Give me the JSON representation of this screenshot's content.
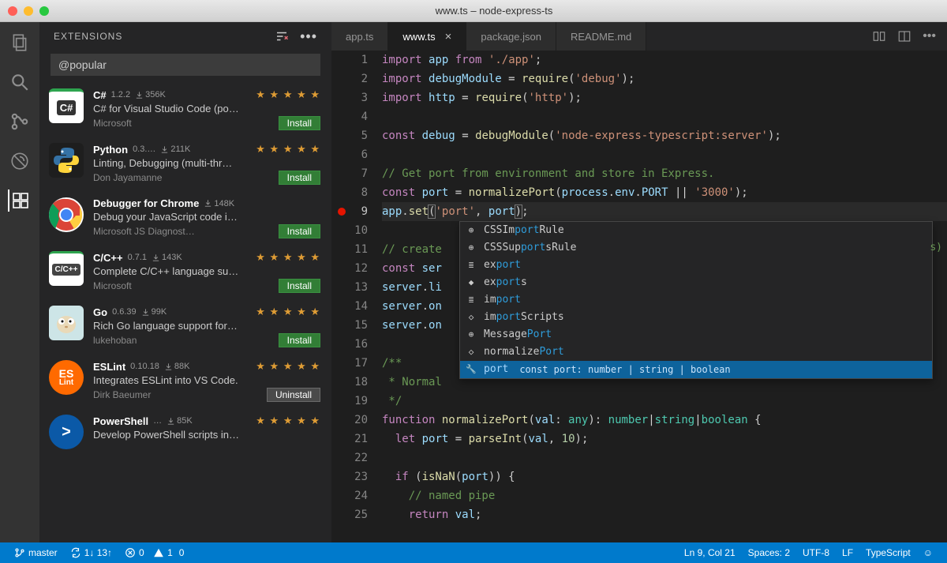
{
  "window": {
    "title": "www.ts – node-express-ts"
  },
  "sidebar": {
    "heading": "EXTENSIONS",
    "search_value": "@popular"
  },
  "extensions": [
    {
      "name": "C#",
      "ver": "1.2.2",
      "downloads": "356K",
      "stars": "★ ★ ★ ★ ★",
      "desc": "C# for Visual Studio Code (po…",
      "publisher": "Microsoft",
      "button": "Install",
      "icon_bg": "#fff",
      "icon_label": "C#",
      "icon_color": "#333",
      "icon_style": "csharp"
    },
    {
      "name": "Python",
      "ver": "0.3.…",
      "downloads": "211K",
      "stars": "★ ★ ★ ★ ★",
      "desc": "Linting, Debugging (multi-thr…",
      "publisher": "Don Jayamanne",
      "button": "Install",
      "icon_bg": "#1e1e1e",
      "icon_label": "Py",
      "icon_color": "#ffd43b",
      "icon_style": "python"
    },
    {
      "name": "Debugger for Chrome",
      "ver": "",
      "downloads": "148K",
      "stars": "",
      "desc": "Debug your JavaScript code i…",
      "publisher": "Microsoft JS Diagnost…",
      "button": "Install",
      "icon_bg": "#fff",
      "icon_label": "",
      "icon_color": "",
      "icon_style": "chrome"
    },
    {
      "name": "C/C++",
      "ver": "0.7.1",
      "downloads": "143K",
      "stars": "★ ★ ★ ★ ★",
      "desc": "Complete C/C++ language su…",
      "publisher": "Microsoft",
      "button": "Install",
      "icon_bg": "#fff",
      "icon_label": "C/C++",
      "icon_color": "#333",
      "icon_style": "cpp"
    },
    {
      "name": "Go",
      "ver": "0.6.39",
      "downloads": "99K",
      "stars": "★ ★ ★ ★ ★",
      "desc": "Rich Go language support for…",
      "publisher": "lukehoban",
      "button": "Install",
      "icon_bg": "#d9e9ea",
      "icon_label": "Go",
      "icon_color": "#333",
      "icon_style": "go"
    },
    {
      "name": "ESLint",
      "ver": "0.10.18",
      "downloads": "88K",
      "stars": "★ ★ ★ ★ ★",
      "desc": "Integrates ESLint into VS Code.",
      "publisher": "Dirk Baeumer",
      "button": "Uninstall",
      "icon_bg": "#ff6a00",
      "icon_label": "ES Lint",
      "icon_color": "#fff",
      "icon_style": "eslint"
    },
    {
      "name": "PowerShell",
      "ver": "…",
      "downloads": "85K",
      "stars": "★ ★ ★ ★ ★",
      "desc": "Develop PowerShell scripts in…",
      "publisher": "",
      "button": "",
      "icon_bg": "#0b59a7",
      "icon_label": ">",
      "icon_color": "#fff",
      "icon_style": "ps"
    }
  ],
  "tabs": [
    {
      "label": "app.ts",
      "active": false
    },
    {
      "label": "www.ts",
      "active": true
    },
    {
      "label": "package.json",
      "active": false
    },
    {
      "label": "README.md",
      "active": false
    }
  ],
  "code_lines": [
    {
      "n": 1,
      "html": "<span class='kw'>import</span> <span class='var'>app</span> <span class='kw'>from</span> <span class='str'>'./app'</span>;"
    },
    {
      "n": 2,
      "html": "<span class='kw'>import</span> <span class='var'>debugModule</span> <span class='op'>=</span> <span class='fn'>require</span>(<span class='str'>'debug'</span>);"
    },
    {
      "n": 3,
      "html": "<span class='kw'>import</span> <span class='var'>http</span> <span class='op'>=</span> <span class='fn'>require</span>(<span class='str'>'http'</span>);"
    },
    {
      "n": 4,
      "html": ""
    },
    {
      "n": 5,
      "html": "<span class='kw'>const</span> <span class='var'>debug</span> <span class='op'>=</span> <span class='fn'>debugModule</span>(<span class='str'>'node-express-typescript:server'</span>);"
    },
    {
      "n": 6,
      "html": ""
    },
    {
      "n": 7,
      "html": "<span class='cm'>// Get port from environment and store in Express.</span>"
    },
    {
      "n": 8,
      "html": "<span class='kw'>const</span> <span class='var'>port</span> <span class='op'>=</span> <span class='fn'>normalizePort</span>(<span class='var'>process</span>.<span class='var'>env</span>.<span class='var'>PORT</span> <span class='op'>||</span> <span class='str'>'3000'</span>);"
    },
    {
      "n": 9,
      "html": "<span class='var'>app</span>.<span class='fn'>set</span><span class='hlchar'>(</span><span class='str'>'port'</span>, <span class='var'>port</span><span class='hlchar'>)</span>;",
      "current": true
    },
    {
      "n": 10,
      "html": ""
    },
    {
      "n": 11,
      "html": "<span class='cm'>// create</span>"
    },
    {
      "n": 12,
      "html": "<span class='kw'>const</span> <span class='var'>ser</span>"
    },
    {
      "n": 13,
      "html": "<span class='var'>server</span>.<span class='var'>li</span>"
    },
    {
      "n": 14,
      "html": "<span class='var'>server</span>.<span class='var'>on</span>"
    },
    {
      "n": 15,
      "html": "<span class='var'>server</span>.<span class='var'>on</span>"
    },
    {
      "n": 16,
      "html": ""
    },
    {
      "n": 17,
      "html": "<span class='cm'>/**</span>"
    },
    {
      "n": 18,
      "html": "<span class='cm'> * Normal</span>"
    },
    {
      "n": 19,
      "html": "<span class='cm'> */</span>"
    },
    {
      "n": 20,
      "html": "<span class='kw'>function</span> <span class='fn'>normalizePort</span>(<span class='var'>val</span>: <span class='tp'>any</span>): <span class='tp'>number</span><span class='op'>|</span><span class='tp'>string</span><span class='op'>|</span><span class='tp'>boolean</span> {"
    },
    {
      "n": 21,
      "html": "  <span class='kw'>let</span> <span class='var'>port</span> <span class='op'>=</span> <span class='fn'>parseInt</span>(<span class='var'>val</span>, <span class='num'>10</span>);"
    },
    {
      "n": 22,
      "html": ""
    },
    {
      "n": 23,
      "html": "  <span class='kw'>if</span> (<span class='fn'>isNaN</span>(<span class='var'>port</span>)) {"
    },
    {
      "n": 24,
      "html": "    <span class='cm'>// named pipe</span>"
    },
    {
      "n": 25,
      "html": "    <span class='kw'>return</span> <span class='var'>val</span>;"
    }
  ],
  "suggestions": [
    {
      "icon": "⊕",
      "pre": "CSSIm",
      "match": "port",
      "post": "Rule",
      "sel": false
    },
    {
      "icon": "⊕",
      "pre": "CSSSup",
      "match": "port",
      "post": "sRule",
      "sel": false
    },
    {
      "icon": "≣",
      "pre": "ex",
      "match": "port",
      "post": "",
      "sel": false
    },
    {
      "icon": "◆",
      "pre": "ex",
      "match": "port",
      "post": "s",
      "sel": false
    },
    {
      "icon": "≣",
      "pre": "im",
      "match": "port",
      "post": "",
      "sel": false
    },
    {
      "icon": "◇",
      "pre": "im",
      "match": "port",
      "post": "Scripts",
      "sel": false
    },
    {
      "icon": "⊕",
      "pre": "Message",
      "match": "Port",
      "post": "",
      "sel": false
    },
    {
      "icon": "◇",
      "pre": "normalize",
      "match": "Port",
      "post": "",
      "sel": false
    },
    {
      "icon": "🔧",
      "pre": "",
      "match": "port",
      "post": "",
      "hint": "const port: number | string | boolean",
      "sel": true
    }
  ],
  "status": {
    "branch": "master",
    "sync": "1↓ 13↑",
    "errors": "0",
    "warnings": "1",
    "info": "0",
    "lncol": "Ln 9, Col 21",
    "spaces": "Spaces: 2",
    "encoding": "UTF-8",
    "eol": "LF",
    "lang": "TypeScript"
  },
  "minimap_hint": "s)"
}
